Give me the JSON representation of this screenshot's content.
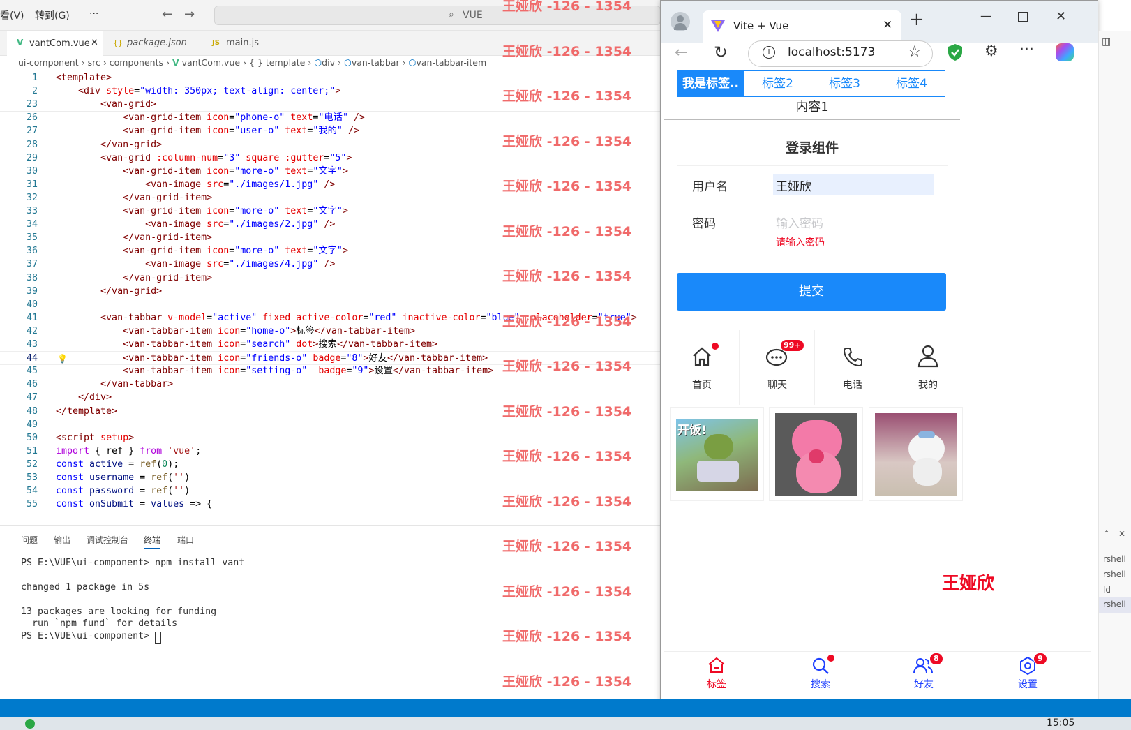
{
  "vscode": {
    "menu": [
      "看(V)",
      "转到(G)",
      "···"
    ],
    "search_label": "VUE",
    "tabs": [
      {
        "icon": "vue-icon",
        "label": "vantCom.vue",
        "close": "✕",
        "active": true
      },
      {
        "icon": "json-icon",
        "label": "package.json",
        "active": false
      },
      {
        "icon": "js-icon",
        "label": "main.js",
        "active": false
      }
    ],
    "breadcrumb": [
      "ui-component",
      "src",
      "components",
      "vantCom.vue",
      "{ } template",
      "div",
      "van-tabbar",
      "van-tabbar-item"
    ],
    "lines": [
      {
        "n": "1",
        "text": "<template>"
      },
      {
        "n": "2",
        "text": "    <div style=\"width: 350px; text-align: center;\">"
      },
      {
        "n": "23",
        "text": "        <van-grid>"
      },
      {
        "n": "26",
        "text": "            <van-grid-item icon=\"phone-o\" text=\"电话\" />"
      },
      {
        "n": "27",
        "text": "            <van-grid-item icon=\"user-o\" text=\"我的\" />"
      },
      {
        "n": "28",
        "text": "        </van-grid>"
      },
      {
        "n": "29",
        "text": "        <van-grid :column-num=\"3\" square :gutter=\"5\">"
      },
      {
        "n": "30",
        "text": "            <van-grid-item icon=\"more-o\" text=\"文字\">"
      },
      {
        "n": "31",
        "text": "                <van-image src=\"./images/1.jpg\" />"
      },
      {
        "n": "32",
        "text": "            </van-grid-item>"
      },
      {
        "n": "33",
        "text": "            <van-grid-item icon=\"more-o\" text=\"文字\">"
      },
      {
        "n": "34",
        "text": "                <van-image src=\"./images/2.jpg\" />"
      },
      {
        "n": "35",
        "text": "            </van-grid-item>"
      },
      {
        "n": "36",
        "text": "            <van-grid-item icon=\"more-o\" text=\"文字\">"
      },
      {
        "n": "37",
        "text": "                <van-image src=\"./images/4.jpg\" />"
      },
      {
        "n": "38",
        "text": "            </van-grid-item>"
      },
      {
        "n": "39",
        "text": "        </van-grid>"
      },
      {
        "n": "40",
        "text": ""
      },
      {
        "n": "41",
        "text": "        <van-tabbar v-model=\"active\" fixed active-color=\"red\" inactive-color=\"blue\" :placeholder=\"true\">"
      },
      {
        "n": "42",
        "text": "            <van-tabbar-item icon=\"home-o\">标签</van-tabbar-item>"
      },
      {
        "n": "43",
        "text": "            <van-tabbar-item icon=\"search\" dot>搜索</van-tabbar-item>"
      },
      {
        "n": "44",
        "text": "            <van-tabbar-item icon=\"friends-o\" badge=\"8\">好友</van-tabbar-item>"
      },
      {
        "n": "45",
        "text": "            <van-tabbar-item icon=\"setting-o\"  badge=\"9\">设置</van-tabbar-item>"
      },
      {
        "n": "46",
        "text": "        </van-tabbar>"
      },
      {
        "n": "47",
        "text": "    </div>"
      },
      {
        "n": "48",
        "text": "</template>"
      },
      {
        "n": "49",
        "text": ""
      },
      {
        "n": "50",
        "text": "<script setup>"
      },
      {
        "n": "51",
        "text": "import { ref } from 'vue';"
      },
      {
        "n": "52",
        "text": "const active = ref(0);"
      },
      {
        "n": "53",
        "text": "const username = ref('')"
      },
      {
        "n": "54",
        "text": "const password = ref('')"
      },
      {
        "n": "55",
        "text": "const onSubmit = values => {"
      }
    ],
    "panel_tabs": [
      "问题",
      "输出",
      "调试控制台",
      "终端",
      "端口"
    ],
    "terminal": [
      "PS E:\\VUE\\ui-component> npm install vant",
      "",
      "changed 1 package in 5s",
      "",
      "13 packages are looking for funding",
      "  run `npm fund` for details",
      "PS E:\\VUE\\ui-component> "
    ],
    "watermark": "王娅欣 -126 - 1354"
  },
  "browser": {
    "tab_title": "Vite + Vue",
    "url": "localhost:5173",
    "vtabs": [
      "我是标签..",
      "标签2",
      "标签3",
      "标签4"
    ],
    "content": "内容1",
    "form_title": "登录组件",
    "username_label": "用户名",
    "username_value": "王娅欣",
    "password_label": "密码",
    "password_placeholder": "输入密码",
    "password_error": "请输入密码",
    "submit_label": "提交",
    "grid": [
      {
        "icon": "home-icon",
        "label": "首页",
        "dot": true
      },
      {
        "icon": "chat-icon",
        "label": "聊天",
        "badge": "99+"
      },
      {
        "icon": "phone-icon",
        "label": "电话"
      },
      {
        "icon": "user-icon",
        "label": "我的"
      }
    ],
    "signature": "王娅欣",
    "tabbar": [
      {
        "icon": "home-icon",
        "label": "标签",
        "active": true
      },
      {
        "icon": "search-icon",
        "label": "搜索",
        "dot": true
      },
      {
        "icon": "friends-icon",
        "label": "好友",
        "badge": "8"
      },
      {
        "icon": "setting-icon",
        "label": "设置",
        "badge": "9"
      }
    ],
    "colors": {
      "primary": "#1989fa",
      "danger": "#ee0a24",
      "inactive": "#1e40ff"
    }
  },
  "taskbar": {
    "time": "15:05"
  },
  "right_strip": [
    "rshell",
    "rshell",
    "ld",
    "rshell"
  ]
}
